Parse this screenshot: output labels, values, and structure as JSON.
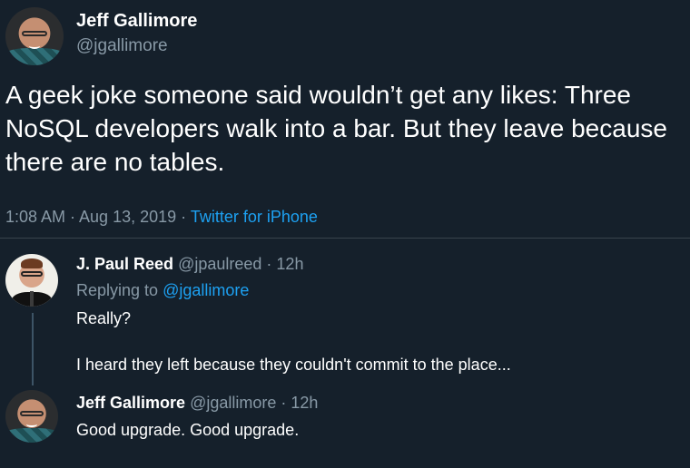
{
  "main_tweet": {
    "author_name": "Jeff Gallimore",
    "author_handle": "@jgallimore",
    "text": "A geek joke someone said wouldn’t get any likes: Three NoSQL developers walk into a bar. But they leave because there are no tables.",
    "timestamp": "1:08 AM · Aug 13, 2019 ·",
    "source": "Twitter for iPhone"
  },
  "replies": [
    {
      "author_name": "J. Paul Reed",
      "author_handle": "@jpaulreed",
      "age": "· 12h",
      "replying_prefix": "Replying to",
      "replying_to": "@jgallimore",
      "lines": [
        "Really?",
        "I heard they left because they couldn't commit to the place..."
      ]
    },
    {
      "author_name": "Jeff Gallimore",
      "author_handle": "@jgallimore",
      "age": "· 12h",
      "lines": [
        "Good upgrade. Good upgrade."
      ]
    }
  ],
  "colors": {
    "background": "#15202b",
    "secondary_text": "#8899a6",
    "link": "#1da1f2",
    "divider": "#38444d"
  }
}
